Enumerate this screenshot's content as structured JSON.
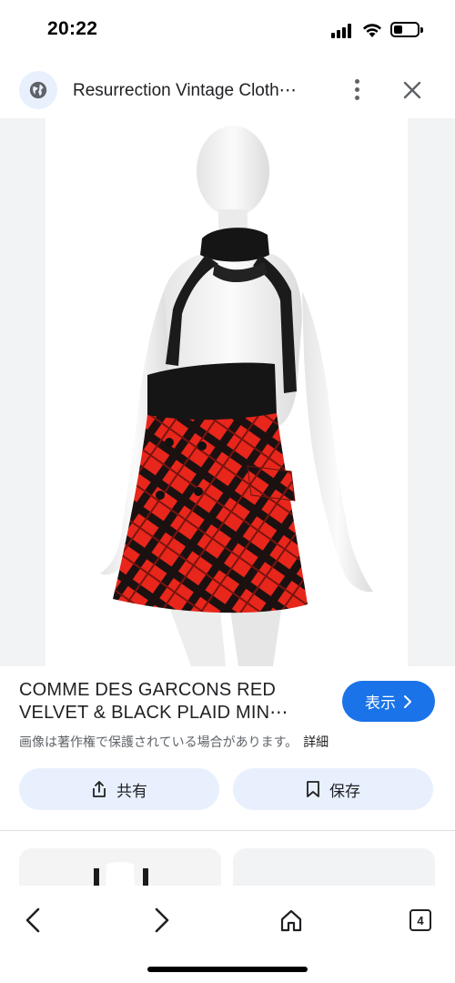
{
  "status": {
    "time": "20:22"
  },
  "header": {
    "site_title": "Resurrection Vintage Cloth⋯"
  },
  "result": {
    "title_line1": "COMME DES GARCONS RED",
    "title_line2": "VELVET & BLACK PLAID MIN⋯",
    "visit_label": "表示",
    "copyright_notice": "画像は著作権で保護されている場合があります。",
    "details_link": "詳細"
  },
  "actions": {
    "share_label": "共有",
    "save_label": "保存"
  },
  "nav": {
    "tab_count": "4"
  },
  "colors": {
    "accent": "#1a73e8",
    "chip": "#e8f0fe",
    "skirt_red": "#e8261b"
  }
}
